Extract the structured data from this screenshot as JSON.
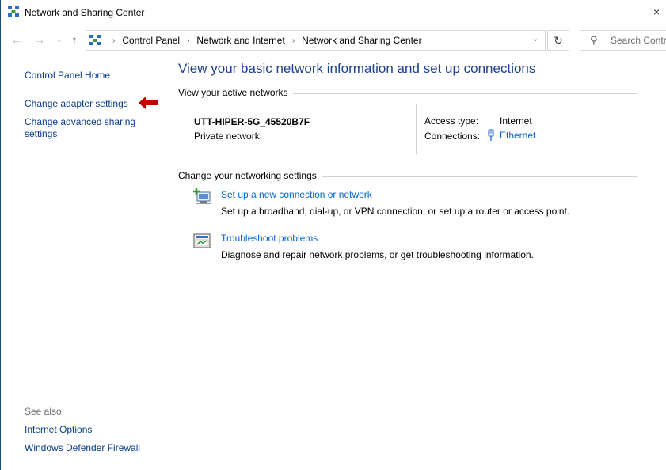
{
  "window": {
    "title": "Network and Sharing Center",
    "close_glyph": "×"
  },
  "nav": {
    "back_glyph": "←",
    "forward_glyph": "→",
    "recent_glyph": "⌄",
    "up_glyph": "↑",
    "refresh_glyph": "↻",
    "dropdown_glyph": "⌄",
    "crumb_separator": "›"
  },
  "address": {
    "crumbs": [
      "Control Panel",
      "Network and Internet",
      "Network and Sharing Center"
    ]
  },
  "search": {
    "placeholder": "Search Control Panel",
    "icon_glyph": "⚲"
  },
  "left_pane": {
    "home": "Control Panel Home",
    "adapter": "Change adapter settings",
    "advanced": "Change advanced sharing settings",
    "see_also": "See also",
    "internet_options": "Internet Options",
    "firewall": "Windows Defender Firewall"
  },
  "main": {
    "title": "View your basic network information and set up connections",
    "active_networks_label": "View your active networks",
    "network": {
      "name": "UTT-HIPER-5G_45520B7F",
      "category": "Private network",
      "access_type_label": "Access type:",
      "access_type_value": "Internet",
      "connections_label": "Connections:",
      "connection_name": "Ethernet"
    },
    "change_settings_label": "Change your networking settings",
    "tasks": [
      {
        "link": "Set up a new connection or network",
        "desc": "Set up a broadband, dial-up, or VPN connection; or set up a router or access point."
      },
      {
        "link": "Troubleshoot problems",
        "desc": "Diagnose and repair network problems, or get troubleshooting information."
      }
    ]
  },
  "colors": {
    "link": "#0066cc",
    "left_link": "#0a3d8a",
    "title_blue": "#1e3f8c",
    "arrow_red": "#c00000"
  }
}
